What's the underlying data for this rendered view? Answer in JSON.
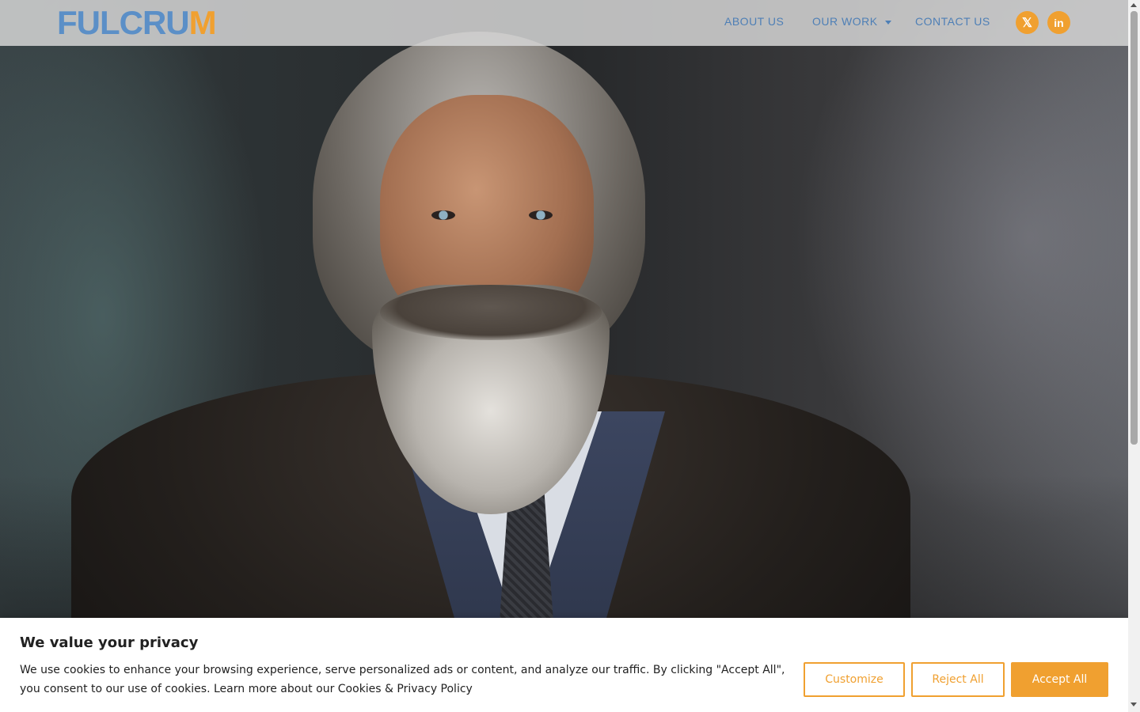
{
  "header": {
    "logo_main": "FULCRU",
    "logo_accent": "M",
    "nav": {
      "about": "ABOUT US",
      "work": "OUR WORK",
      "contact": "CONTACT US"
    },
    "social": {
      "x_glyph": "𝕏",
      "linkedin_glyph": "in"
    }
  },
  "hero": {
    "image_alt": "Portrait of a bearded man in a dark coat"
  },
  "cookie_banner": {
    "title": "We value your privacy",
    "text": "We use cookies to enhance your browsing experience, serve personalized ads or content, and analyze our traffic. By clicking \"Accept All\", you consent to our use of cookies. Learn more about our ",
    "link_text": "Cookies & Privacy Policy",
    "customize_label": "Customize",
    "reject_label": "Reject All",
    "accept_label": "Accept All"
  },
  "colors": {
    "brand_blue": "#5b8fc7",
    "brand_orange": "#f0a030"
  },
  "icons": [
    "x-twitter-icon",
    "linkedin-icon",
    "chevron-down-icon"
  ]
}
